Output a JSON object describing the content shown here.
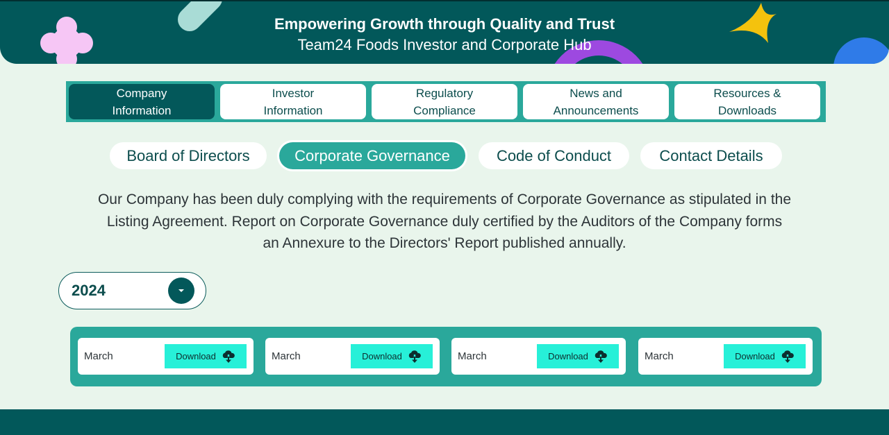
{
  "hero": {
    "title": "Empowering Growth through Quality and Trust",
    "subtitle": "Team24 Foods Investor and Corporate Hub"
  },
  "nav": {
    "items": [
      {
        "label": "Company\nInformation",
        "active": true
      },
      {
        "label": "Investor\nInformation",
        "active": false
      },
      {
        "label": "Regulatory\nCompliance",
        "active": false
      },
      {
        "label": "News and\nAnnouncements",
        "active": false
      },
      {
        "label": "Resources &\nDownloads",
        "active": false
      }
    ]
  },
  "sub_tabs": [
    {
      "label": "Board of Directors",
      "active": false
    },
    {
      "label": "Corporate Governance",
      "active": true
    },
    {
      "label": "Code of Conduct",
      "active": false
    },
    {
      "label": "Contact Details",
      "active": false
    }
  ],
  "description": "Our Company has been duly complying with the requirements of Corporate Governance as stipulated in the Listing Agreement. Report on Corporate Governance duly certified by the Auditors of the Company forms an Annexure to the Directors' Report published annually.",
  "year_select": {
    "value": "2024"
  },
  "documents": [
    {
      "label": "March",
      "button": "Download",
      "icon": "cloud-download-icon"
    },
    {
      "label": "March",
      "button": "Download",
      "icon": "cloud-download-icon"
    },
    {
      "label": "March",
      "button": "Download",
      "icon": "cloud-download-icon"
    },
    {
      "label": "March",
      "button": "Download",
      "icon": "cloud-download-icon"
    }
  ],
  "colors": {
    "primary": "#02585a",
    "accent": "#2aa89b",
    "button": "#27f0d8",
    "background": "#e9f5ec"
  }
}
